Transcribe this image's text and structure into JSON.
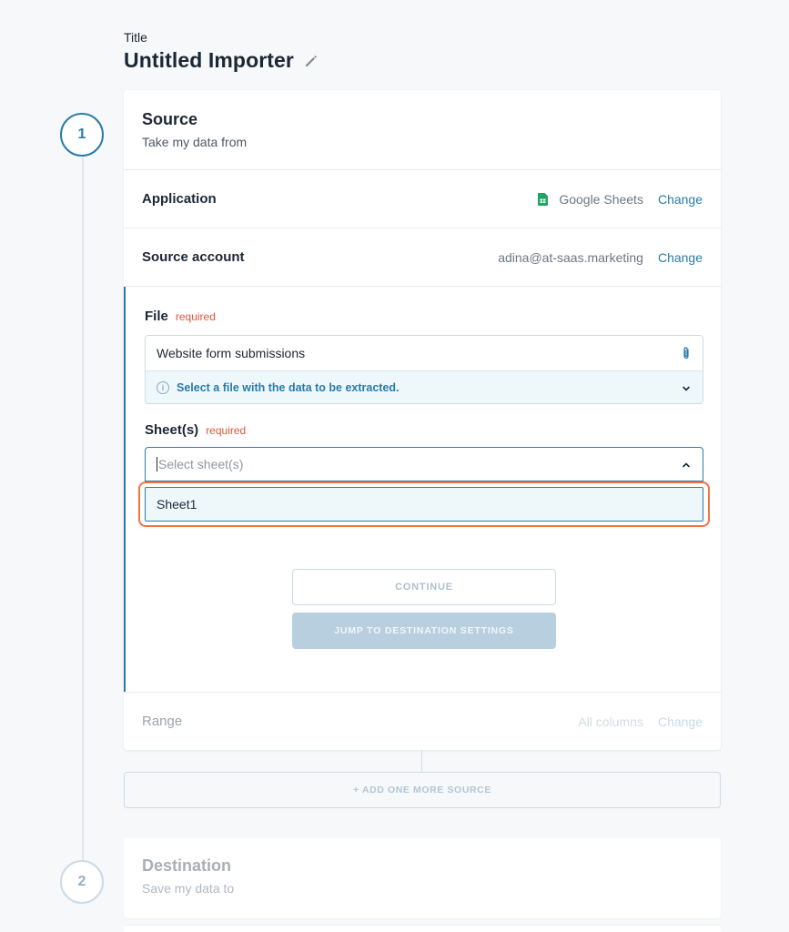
{
  "header": {
    "title_label": "Title",
    "title": "Untitled Importer"
  },
  "steps": [
    {
      "number": "1"
    },
    {
      "number": "2"
    }
  ],
  "source": {
    "title": "Source",
    "subtitle": "Take my data from",
    "application": {
      "label": "Application",
      "value": "Google Sheets",
      "change": "Change"
    },
    "account": {
      "label": "Source account",
      "value": "adina@at-saas.marketing",
      "change": "Change"
    },
    "file": {
      "label": "File",
      "required": "required",
      "value": "Website form submissions",
      "hint": "Select a file with the data to be extracted."
    },
    "sheets": {
      "label": "Sheet(s)",
      "required": "required",
      "placeholder": "Select sheet(s)",
      "options": [
        "Sheet1"
      ]
    },
    "continue_label": "CONTINUE",
    "jump_label": "JUMP TO DESTINATION SETTINGS",
    "range": {
      "label": "Range",
      "value": "All columns",
      "change": "Change"
    }
  },
  "add_source_label": "+ ADD ONE MORE SOURCE",
  "destination": {
    "title": "Destination",
    "subtitle": "Save my data to"
  },
  "colors": {
    "accent": "#2a7ba8",
    "required": "#e0533d",
    "highlight": "#ee7444",
    "sheets_green": "#1fa463"
  }
}
